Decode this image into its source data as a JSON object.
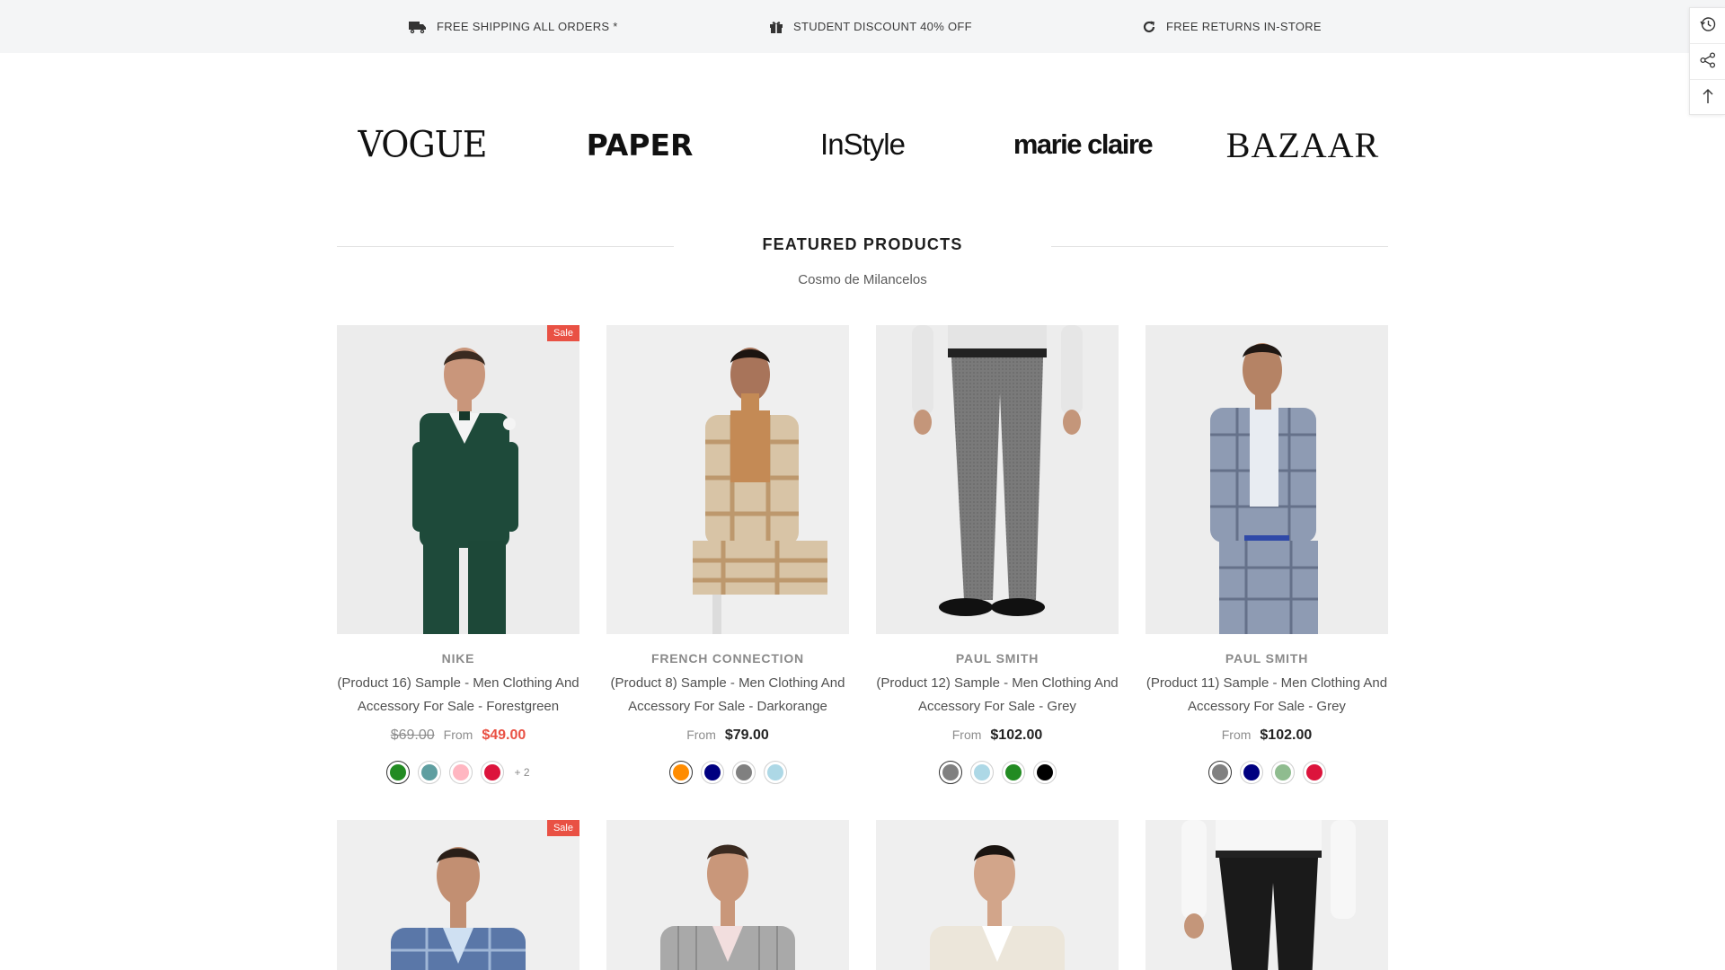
{
  "topbar": {
    "items": [
      {
        "icon": "truck-icon",
        "label": "FREE SHIPPING ALL ORDERS *"
      },
      {
        "icon": "gift-icon",
        "label": "STUDENT DISCOUNT 40% OFF"
      },
      {
        "icon": "refresh-icon",
        "label": "FREE RETURNS IN-STORE"
      }
    ]
  },
  "floating_toolbar": {
    "buttons": [
      "history-icon",
      "share-icon",
      "back-to-top-icon"
    ]
  },
  "brands": [
    "VOGUE",
    "PAPER",
    "InStyle",
    "marie claire",
    "BAZAAR"
  ],
  "section": {
    "title": "FEATURED PRODUCTS",
    "subtitle": "Cosmo de Milancelos"
  },
  "products": [
    {
      "badge": "Sale",
      "vendor": "NIKE",
      "title": "(Product 16) Sample - Men Clothing And Accessory For Sale - Forestgreen",
      "price_old": "$69.00",
      "price_prefix": "From",
      "price": "$49.00",
      "on_sale": true,
      "swatches": [
        "#228b22",
        "#5f9ea0",
        "#ffb6c1",
        "#dc143c"
      ],
      "more": "+ 2"
    },
    {
      "vendor": "FRENCH CONNECTION",
      "title": "(Product 8) Sample - Men Clothing And Accessory For Sale - Darkorange",
      "price_prefix": "From",
      "price": "$79.00",
      "swatches": [
        "#ff8c00",
        "#000080",
        "#808080",
        "#add8e6"
      ]
    },
    {
      "vendor": "PAUL SMITH",
      "title": "(Product 12) Sample - Men Clothing And Accessory For Sale - Grey",
      "price_prefix": "From",
      "price": "$102.00",
      "swatches": [
        "#808080",
        "#add8e6",
        "#228b22",
        "#000000"
      ]
    },
    {
      "vendor": "PAUL SMITH",
      "title": "(Product 11) Sample - Men Clothing And Accessory For Sale - Grey",
      "price_prefix": "From",
      "price": "$102.00",
      "swatches": [
        "#808080",
        "#000080",
        "#8fbc8f",
        "#dc143c"
      ]
    }
  ],
  "products_row2": [
    {
      "badge": "Sale"
    },
    {},
    {},
    {}
  ],
  "colors": {
    "sale": "#e95144",
    "topbar_bg": "#f4f5f6",
    "text": "#232323"
  }
}
